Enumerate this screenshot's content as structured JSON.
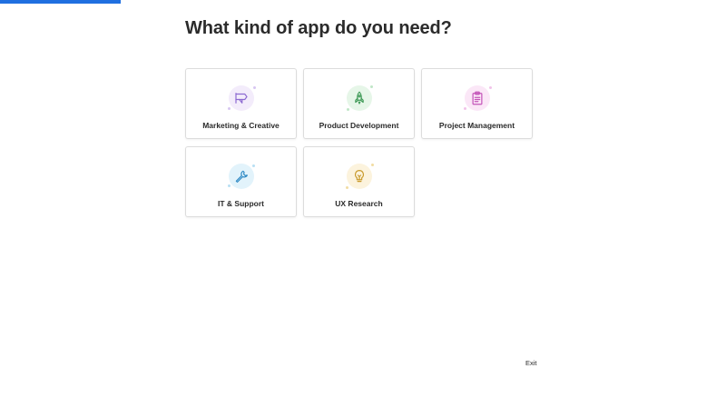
{
  "progress": {
    "fraction": 0.166,
    "color": "#1f6fe0"
  },
  "page_title": "What kind of app do you need?",
  "cards": [
    {
      "label": "Marketing & Creative",
      "icon": "megaphone-icon",
      "accent": "#8d6ad1",
      "tint": "#f3ecfb"
    },
    {
      "label": "Product Development",
      "icon": "rocket-icon",
      "accent": "#3f9a57",
      "tint": "#e6f6e8"
    },
    {
      "label": "Project Management",
      "icon": "clipboard-icon",
      "accent": "#c454b8",
      "tint": "#fbe7f7"
    },
    {
      "label": "IT & Support",
      "icon": "wrench-icon",
      "accent": "#2a87c3",
      "tint": "#e2f3fb"
    },
    {
      "label": "UX Research",
      "icon": "lightbulb-icon",
      "accent": "#c99a2b",
      "tint": "#fcf3dd"
    }
  ],
  "exit_label": "Exit"
}
